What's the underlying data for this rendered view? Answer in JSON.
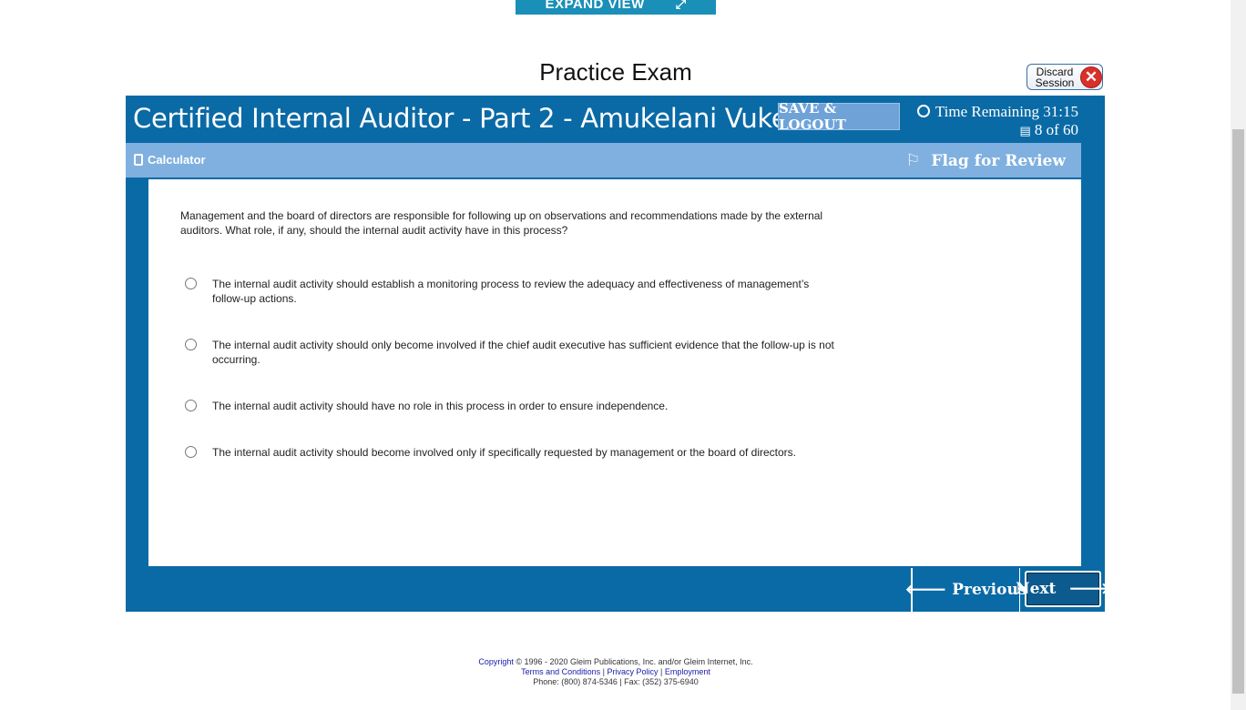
{
  "expand_view": {
    "label": "EXPAND VIEW",
    "icon": "expand-arrow-icon"
  },
  "page_title": "Practice Exam",
  "discard": {
    "label_line1": "Discard",
    "label_line2": "Session",
    "icon": "close-icon"
  },
  "header": {
    "exam_title": "Certified Internal Auditor - Part 2 - Amukelani Vukela",
    "save_logout": "SAVE & LOGOUT",
    "time_remaining_label": "Time Remaining 31:15",
    "question_count": "8 of 60"
  },
  "toolbar": {
    "calculator": "Calculator",
    "flag_for_review": "Flag for Review"
  },
  "question": {
    "text": "Management and the board of directors are responsible for following up on observations and recommendations made by the external auditors. What role, if any, should the internal audit activity have in this process?",
    "options": [
      "The internal audit activity should establish a monitoring process to review the adequacy and effectiveness of management’s follow-up actions.",
      "The internal audit activity should only become involved if the chief audit executive has sufficient evidence that the follow-up is not occurring.",
      "The internal audit activity should have no role in this process in order to ensure independence.",
      "The internal audit activity should become involved only if specifically requested by management or the board of directors."
    ]
  },
  "navigation": {
    "previous": "Previous",
    "next": "Next"
  },
  "footer": {
    "copyright_link": "Copyright",
    "copyright_text": " © 1996 - 2020 Gleim Publications, Inc. and/or Gleim Internet, Inc.",
    "links": [
      "Terms and Conditions",
      "Privacy Policy",
      "Employment"
    ],
    "phone": "Phone: (800) 874-5346 | Fax: (352) 375-6940"
  },
  "colors": {
    "frame_blue": "#0a6aa6",
    "toolbar_blue": "#7fb0df",
    "save_button": "#6fa3d8",
    "discard_red": "#d9302b"
  }
}
